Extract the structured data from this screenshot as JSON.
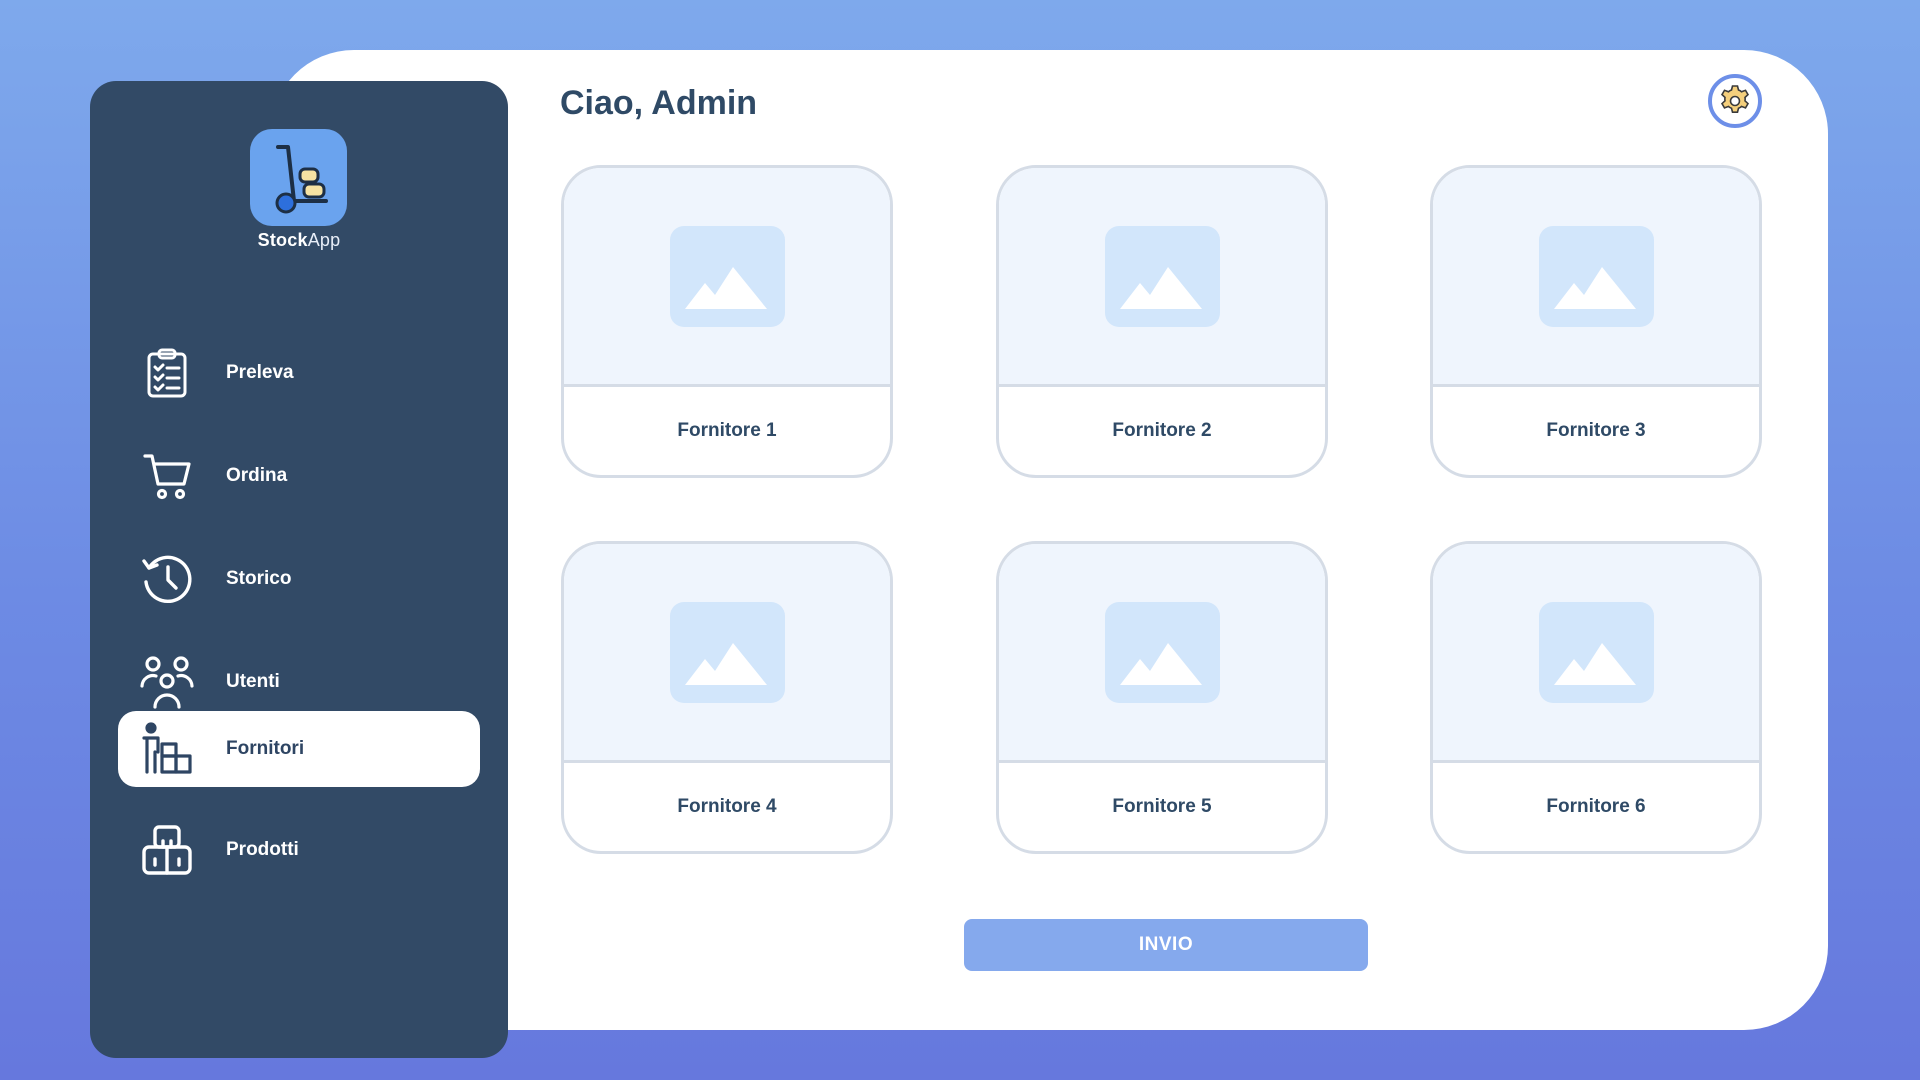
{
  "app": {
    "name_bold": "Stock",
    "name_light": "App"
  },
  "header": {
    "greeting": "Ciao, Admin",
    "settings_icon": "gear-icon"
  },
  "sidebar": {
    "items": [
      {
        "label": "Preleva",
        "icon": "clipboard-checklist-icon",
        "active": false
      },
      {
        "label": "Ordina",
        "icon": "cart-icon",
        "active": false
      },
      {
        "label": "Storico",
        "icon": "history-icon",
        "active": false
      },
      {
        "label": "Utenti",
        "icon": "users-icon",
        "active": false
      },
      {
        "label": "Fornitori",
        "icon": "supplier-boxes-icon",
        "active": true
      },
      {
        "label": "Prodotti",
        "icon": "box-icon",
        "active": false
      }
    ]
  },
  "suppliers": [
    {
      "label": "Fornitore 1",
      "icon": "image-placeholder-icon"
    },
    {
      "label": "Fornitore 2",
      "icon": "image-placeholder-icon"
    },
    {
      "label": "Fornitore 3",
      "icon": "image-placeholder-icon"
    },
    {
      "label": "Fornitore 4",
      "icon": "image-placeholder-icon"
    },
    {
      "label": "Fornitore 5",
      "icon": "image-placeholder-icon"
    },
    {
      "label": "Fornitore 6",
      "icon": "image-placeholder-icon"
    }
  ],
  "actions": {
    "send_label": "INVIO"
  },
  "colors": {
    "sidebar_bg": "#324a66",
    "accent": "#6d8fe8",
    "button": "#85a9ed",
    "placeholder": "#d2e6fb"
  }
}
